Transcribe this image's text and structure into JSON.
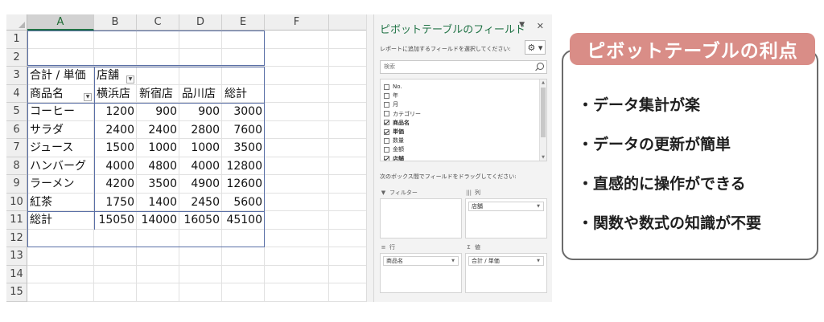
{
  "sheet": {
    "columns": [
      "A",
      "B",
      "C",
      "D",
      "E",
      "F"
    ],
    "rows": [
      "1",
      "2",
      "3",
      "4",
      "5",
      "6",
      "7",
      "8",
      "9",
      "10",
      "11",
      "12",
      "13",
      "14",
      "15"
    ],
    "pivot": {
      "value_header": "合計 / 単価",
      "column_field": "店舗",
      "row_field": "商品名",
      "stores": [
        "横浜店",
        "新宿店",
        "品川店",
        "総計"
      ],
      "body": [
        {
          "name": "コーヒー",
          "values": [
            "1200",
            "900",
            "900",
            "3000"
          ]
        },
        {
          "name": "サラダ",
          "values": [
            "2400",
            "2400",
            "2800",
            "7600"
          ]
        },
        {
          "name": "ジュース",
          "values": [
            "1500",
            "1000",
            "1000",
            "3500"
          ]
        },
        {
          "name": "ハンバーグ",
          "values": [
            "4000",
            "4800",
            "4000",
            "12800"
          ]
        },
        {
          "name": "ラーメン",
          "values": [
            "4200",
            "3500",
            "4900",
            "12600"
          ]
        },
        {
          "name": "紅茶",
          "values": [
            "1750",
            "1400",
            "2450",
            "5600"
          ]
        },
        {
          "name": "総計",
          "values": [
            "15050",
            "14000",
            "16050",
            "45100"
          ]
        }
      ]
    }
  },
  "pane": {
    "title": "ピボットテーブルのフィールド",
    "subtitle": "レポートに追加するフィールドを選択してください:",
    "search_placeholder": "検索",
    "fields": [
      {
        "label": "No.",
        "checked": false,
        "bold": false
      },
      {
        "label": "年",
        "checked": false,
        "bold": false
      },
      {
        "label": "月",
        "checked": false,
        "bold": false
      },
      {
        "label": "カテゴリー",
        "checked": false,
        "bold": false
      },
      {
        "label": "商品名",
        "checked": true,
        "bold": true
      },
      {
        "label": "単価",
        "checked": true,
        "bold": true
      },
      {
        "label": "数量",
        "checked": false,
        "bold": false
      },
      {
        "label": "金額",
        "checked": false,
        "bold": false
      },
      {
        "label": "店舗",
        "checked": true,
        "bold": true
      }
    ],
    "drag_hint": "次のボックス間でフィールドをドラッグしてください:",
    "areas": {
      "filter": {
        "label": "フィルター",
        "item": ""
      },
      "columns": {
        "label": "列",
        "item": "店舗"
      },
      "rows": {
        "label": "行",
        "item": "商品名"
      },
      "values": {
        "label": "値",
        "item": "合計 / 単価"
      }
    }
  },
  "advantages": {
    "title": "ピボットテーブルの利点",
    "points": [
      "・データ集計が楽",
      "・データの更新が簡単",
      "・直感的に操作ができる",
      "・関数や数式の知識が不要"
    ]
  },
  "colors": {
    "excel_green": "#217346",
    "badge": "#d98d87",
    "pivot_border": "#5a6fa6"
  }
}
